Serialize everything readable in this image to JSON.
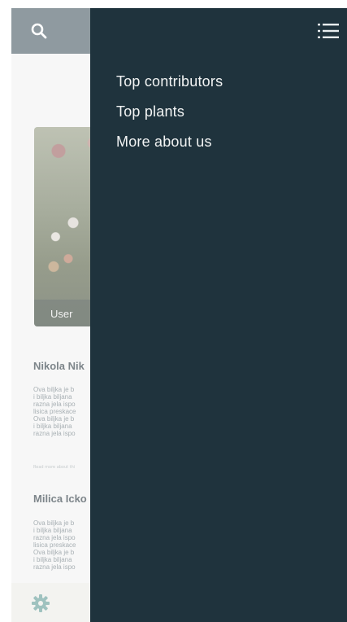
{
  "background": {
    "card_caption": "User",
    "posts": [
      {
        "name": "Nikola Nik",
        "body": "Ova biljka je b\ni biljka biljana\nrazna jela ispo\nlisica preskace\nOva biljka je b\ni biljka biljana\nrazna jela ispo",
        "read_more": "Read more about thi"
      },
      {
        "name": "Milica Icko",
        "body": "Ova biljka je b\ni biljka biljana\nrazna jela ispo\nlisica preskace\nOva biljka je b\ni biljka biljana\nrazna jela ispo"
      }
    ]
  },
  "drawer": {
    "items": [
      {
        "label": "Top contributors"
      },
      {
        "label": "Top plants"
      },
      {
        "label": "More about us"
      }
    ]
  },
  "colors": {
    "drawer_bg": "#1f333d",
    "topbar_bg": "#8f9aa0",
    "text_light": "#f2f4f4"
  },
  "icons": [
    "search-icon",
    "gear-icon",
    "menu-icon"
  ]
}
